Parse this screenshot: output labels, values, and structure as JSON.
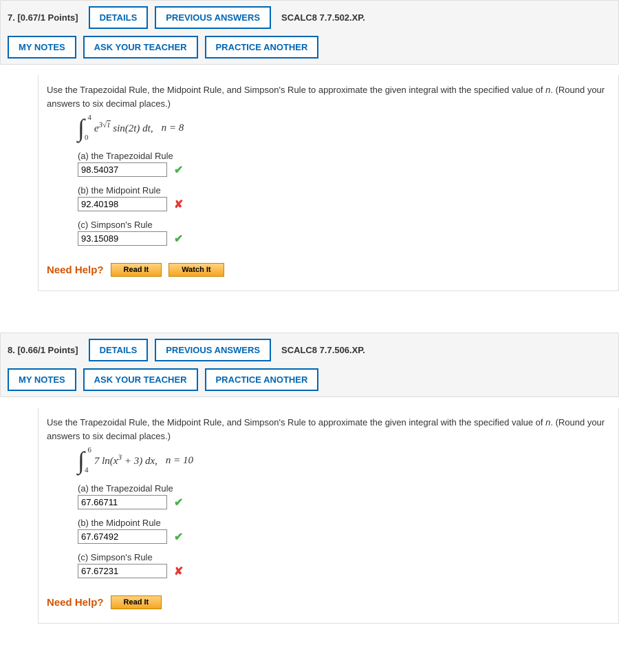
{
  "buttons": {
    "details": "DETAILS",
    "previous_answers": "PREVIOUS ANSWERS",
    "my_notes": "MY NOTES",
    "ask_teacher": "ASK YOUR TEACHER",
    "practice_another": "PRACTICE ANOTHER"
  },
  "help": {
    "label": "Need Help?",
    "read_it": "Read It",
    "watch_it": "Watch It"
  },
  "q7": {
    "number": "7.",
    "points": "[0.67/1 Points]",
    "source": "SCALC8 7.7.502.XP.",
    "prompt": "Use the Trapezoidal Rule, the Midpoint Rule, and Simpson's Rule to approximate the given integral with the specified value of n. (Round your answers to six decimal places.)",
    "integral": {
      "lower": "0",
      "upper": "4",
      "integrand_html": "e<sup>3<span class='sqrt'><span class='sqrt-body'>t</span></span></sup> sin(2<span class='ital'>t</span>) <span class='ital'>dt</span>,",
      "nval": "n = 8"
    },
    "parts": {
      "a_label": "(a) the Trapezoidal Rule",
      "a_value": "98.54037",
      "a_status": "correct",
      "b_label": "(b) the Midpoint Rule",
      "b_value": "92.40198",
      "b_status": "incorrect",
      "c_label": "(c) Simpson's Rule",
      "c_value": "93.15089",
      "c_status": "correct"
    },
    "help_buttons": [
      "read_it",
      "watch_it"
    ]
  },
  "q8": {
    "number": "8.",
    "points": "[0.66/1 Points]",
    "source": "SCALC8 7.7.506.XP.",
    "prompt": "Use the Trapezoidal Rule, the Midpoint Rule, and Simpson's Rule to approximate the given integral with the specified value of n. (Round your answers to six decimal places.)",
    "integral": {
      "lower": "4",
      "upper": "6",
      "integrand_html": "7 ln(<span class='ital'>x</span><sup>3</sup> + 3) <span class='ital'>dx</span>,",
      "nval": "n = 10"
    },
    "parts": {
      "a_label": "(a) the Trapezoidal Rule",
      "a_value": "67.66711",
      "a_status": "correct",
      "b_label": "(b) the Midpoint Rule",
      "b_value": "67.67492",
      "b_status": "correct",
      "c_label": "(c) Simpson's Rule",
      "c_value": "67.67231",
      "c_status": "incorrect"
    },
    "help_buttons": [
      "read_it"
    ]
  }
}
